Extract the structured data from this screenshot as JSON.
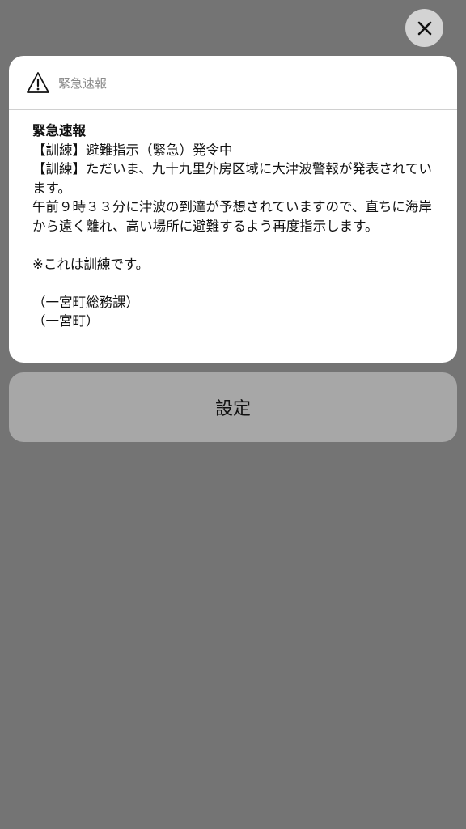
{
  "close_button": {
    "icon": "close-icon"
  },
  "notification": {
    "header": {
      "icon": "warning-triangle-icon",
      "title": "緊急速報"
    },
    "body": {
      "title": "緊急速報",
      "text": "【訓練】避難指示（緊急）発令中\n【訓練】ただいま、九十九里外房区域に大津波警報が発表されています。\n午前９時３３分に津波の到達が予想されていますので、直ちに海岸から遠く離れ、高い場所に避難するよう再度指示します。\n\n※これは訓練です。\n\n（一宮町総務課）\n（一宮町）"
    }
  },
  "settings_button": {
    "label": "設定"
  }
}
